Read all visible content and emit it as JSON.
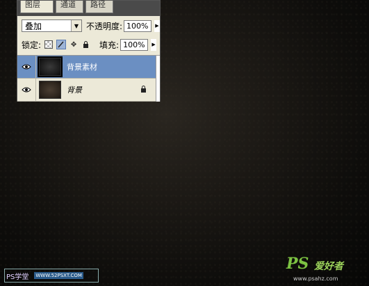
{
  "tabs": [
    {
      "label": "图层 ×"
    },
    {
      "label": "通道"
    },
    {
      "label": "路径"
    }
  ],
  "blend_mode": {
    "value": "叠加"
  },
  "opacity": {
    "label": "不透明度:",
    "value": "100%"
  },
  "lock": {
    "label": "锁定:"
  },
  "fill": {
    "label": "填充:",
    "value": "100%"
  },
  "layers": [
    {
      "name": "背景素材",
      "selected": true
    },
    {
      "name": "背景",
      "selected": false,
      "locked": true
    }
  ],
  "watermark_left": {
    "ps": "PS学堂",
    "site": "WWW.52PSXT.COM"
  },
  "watermark_right": {
    "logo": "PS",
    "cn": "爱好者",
    "url": "www.psahz.com"
  },
  "icons": [
    "eye-icon",
    "lock-icon",
    "brush-icon",
    "move-icon",
    "transparency-icon",
    "dropdown-arrow-icon",
    "flyout-arrow-icon"
  ]
}
